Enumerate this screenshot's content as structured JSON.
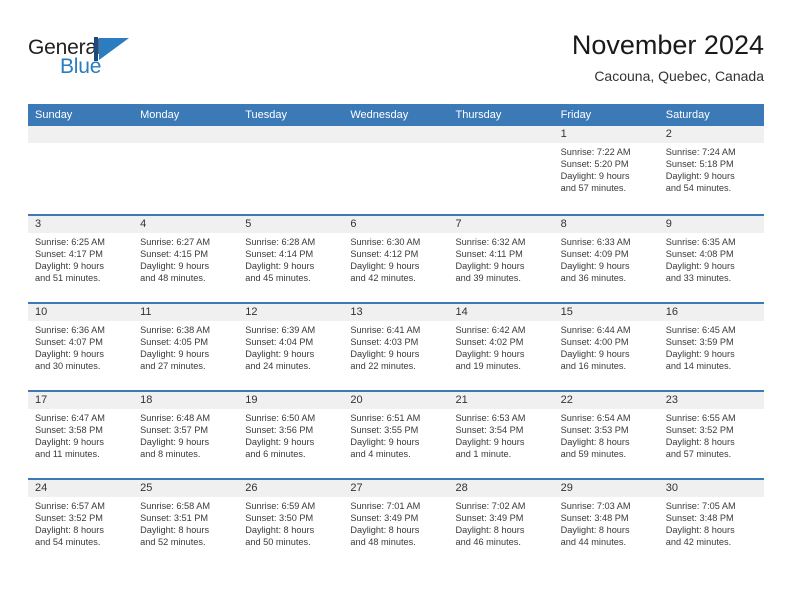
{
  "brand": {
    "name_part1": "General",
    "name_part2": "Blue",
    "mark_icon": "triangle-flag-icon",
    "color_dark": "#1b4a80",
    "color_light": "#2b7cc0"
  },
  "header": {
    "title": "November 2024",
    "subtitle": "Cacouna, Quebec, Canada"
  },
  "calendar": {
    "header_color": "#3b79b7",
    "day_strip_color": "#f0f0f0",
    "weekdays": [
      "Sunday",
      "Monday",
      "Tuesday",
      "Wednesday",
      "Thursday",
      "Friday",
      "Saturday"
    ],
    "weeks": [
      [
        {
          "day": "",
          "empty": true
        },
        {
          "day": "",
          "empty": true
        },
        {
          "day": "",
          "empty": true
        },
        {
          "day": "",
          "empty": true
        },
        {
          "day": "",
          "empty": true
        },
        {
          "day": "1",
          "sunrise": "Sunrise: 7:22 AM",
          "sunset": "Sunset: 5:20 PM",
          "daylight_line1": "Daylight: 9 hours",
          "daylight_line2": "and 57 minutes."
        },
        {
          "day": "2",
          "sunrise": "Sunrise: 7:24 AM",
          "sunset": "Sunset: 5:18 PM",
          "daylight_line1": "Daylight: 9 hours",
          "daylight_line2": "and 54 minutes."
        }
      ],
      [
        {
          "day": "3",
          "sunrise": "Sunrise: 6:25 AM",
          "sunset": "Sunset: 4:17 PM",
          "daylight_line1": "Daylight: 9 hours",
          "daylight_line2": "and 51 minutes."
        },
        {
          "day": "4",
          "sunrise": "Sunrise: 6:27 AM",
          "sunset": "Sunset: 4:15 PM",
          "daylight_line1": "Daylight: 9 hours",
          "daylight_line2": "and 48 minutes."
        },
        {
          "day": "5",
          "sunrise": "Sunrise: 6:28 AM",
          "sunset": "Sunset: 4:14 PM",
          "daylight_line1": "Daylight: 9 hours",
          "daylight_line2": "and 45 minutes."
        },
        {
          "day": "6",
          "sunrise": "Sunrise: 6:30 AM",
          "sunset": "Sunset: 4:12 PM",
          "daylight_line1": "Daylight: 9 hours",
          "daylight_line2": "and 42 minutes."
        },
        {
          "day": "7",
          "sunrise": "Sunrise: 6:32 AM",
          "sunset": "Sunset: 4:11 PM",
          "daylight_line1": "Daylight: 9 hours",
          "daylight_line2": "and 39 minutes."
        },
        {
          "day": "8",
          "sunrise": "Sunrise: 6:33 AM",
          "sunset": "Sunset: 4:09 PM",
          "daylight_line1": "Daylight: 9 hours",
          "daylight_line2": "and 36 minutes."
        },
        {
          "day": "9",
          "sunrise": "Sunrise: 6:35 AM",
          "sunset": "Sunset: 4:08 PM",
          "daylight_line1": "Daylight: 9 hours",
          "daylight_line2": "and 33 minutes."
        }
      ],
      [
        {
          "day": "10",
          "sunrise": "Sunrise: 6:36 AM",
          "sunset": "Sunset: 4:07 PM",
          "daylight_line1": "Daylight: 9 hours",
          "daylight_line2": "and 30 minutes."
        },
        {
          "day": "11",
          "sunrise": "Sunrise: 6:38 AM",
          "sunset": "Sunset: 4:05 PM",
          "daylight_line1": "Daylight: 9 hours",
          "daylight_line2": "and 27 minutes."
        },
        {
          "day": "12",
          "sunrise": "Sunrise: 6:39 AM",
          "sunset": "Sunset: 4:04 PM",
          "daylight_line1": "Daylight: 9 hours",
          "daylight_line2": "and 24 minutes."
        },
        {
          "day": "13",
          "sunrise": "Sunrise: 6:41 AM",
          "sunset": "Sunset: 4:03 PM",
          "daylight_line1": "Daylight: 9 hours",
          "daylight_line2": "and 22 minutes."
        },
        {
          "day": "14",
          "sunrise": "Sunrise: 6:42 AM",
          "sunset": "Sunset: 4:02 PM",
          "daylight_line1": "Daylight: 9 hours",
          "daylight_line2": "and 19 minutes."
        },
        {
          "day": "15",
          "sunrise": "Sunrise: 6:44 AM",
          "sunset": "Sunset: 4:00 PM",
          "daylight_line1": "Daylight: 9 hours",
          "daylight_line2": "and 16 minutes."
        },
        {
          "day": "16",
          "sunrise": "Sunrise: 6:45 AM",
          "sunset": "Sunset: 3:59 PM",
          "daylight_line1": "Daylight: 9 hours",
          "daylight_line2": "and 14 minutes."
        }
      ],
      [
        {
          "day": "17",
          "sunrise": "Sunrise: 6:47 AM",
          "sunset": "Sunset: 3:58 PM",
          "daylight_line1": "Daylight: 9 hours",
          "daylight_line2": "and 11 minutes."
        },
        {
          "day": "18",
          "sunrise": "Sunrise: 6:48 AM",
          "sunset": "Sunset: 3:57 PM",
          "daylight_line1": "Daylight: 9 hours",
          "daylight_line2": "and 8 minutes."
        },
        {
          "day": "19",
          "sunrise": "Sunrise: 6:50 AM",
          "sunset": "Sunset: 3:56 PM",
          "daylight_line1": "Daylight: 9 hours",
          "daylight_line2": "and 6 minutes."
        },
        {
          "day": "20",
          "sunrise": "Sunrise: 6:51 AM",
          "sunset": "Sunset: 3:55 PM",
          "daylight_line1": "Daylight: 9 hours",
          "daylight_line2": "and 4 minutes."
        },
        {
          "day": "21",
          "sunrise": "Sunrise: 6:53 AM",
          "sunset": "Sunset: 3:54 PM",
          "daylight_line1": "Daylight: 9 hours",
          "daylight_line2": "and 1 minute."
        },
        {
          "day": "22",
          "sunrise": "Sunrise: 6:54 AM",
          "sunset": "Sunset: 3:53 PM",
          "daylight_line1": "Daylight: 8 hours",
          "daylight_line2": "and 59 minutes."
        },
        {
          "day": "23",
          "sunrise": "Sunrise: 6:55 AM",
          "sunset": "Sunset: 3:52 PM",
          "daylight_line1": "Daylight: 8 hours",
          "daylight_line2": "and 57 minutes."
        }
      ],
      [
        {
          "day": "24",
          "sunrise": "Sunrise: 6:57 AM",
          "sunset": "Sunset: 3:52 PM",
          "daylight_line1": "Daylight: 8 hours",
          "daylight_line2": "and 54 minutes."
        },
        {
          "day": "25",
          "sunrise": "Sunrise: 6:58 AM",
          "sunset": "Sunset: 3:51 PM",
          "daylight_line1": "Daylight: 8 hours",
          "daylight_line2": "and 52 minutes."
        },
        {
          "day": "26",
          "sunrise": "Sunrise: 6:59 AM",
          "sunset": "Sunset: 3:50 PM",
          "daylight_line1": "Daylight: 8 hours",
          "daylight_line2": "and 50 minutes."
        },
        {
          "day": "27",
          "sunrise": "Sunrise: 7:01 AM",
          "sunset": "Sunset: 3:49 PM",
          "daylight_line1": "Daylight: 8 hours",
          "daylight_line2": "and 48 minutes."
        },
        {
          "day": "28",
          "sunrise": "Sunrise: 7:02 AM",
          "sunset": "Sunset: 3:49 PM",
          "daylight_line1": "Daylight: 8 hours",
          "daylight_line2": "and 46 minutes."
        },
        {
          "day": "29",
          "sunrise": "Sunrise: 7:03 AM",
          "sunset": "Sunset: 3:48 PM",
          "daylight_line1": "Daylight: 8 hours",
          "daylight_line2": "and 44 minutes."
        },
        {
          "day": "30",
          "sunrise": "Sunrise: 7:05 AM",
          "sunset": "Sunset: 3:48 PM",
          "daylight_line1": "Daylight: 8 hours",
          "daylight_line2": "and 42 minutes."
        }
      ]
    ]
  }
}
